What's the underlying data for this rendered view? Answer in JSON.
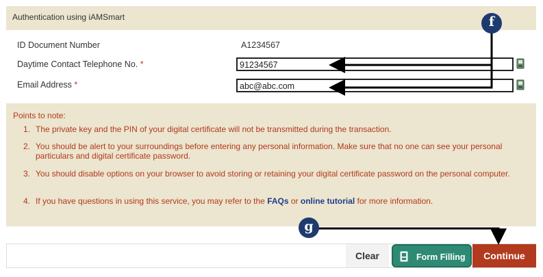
{
  "section": {
    "title": "Authentication using iAMSmart"
  },
  "fields": {
    "id_label": "ID Document Number",
    "id_value": "A1234567",
    "phone_label": "Daytime Contact Telephone No.",
    "phone_value": "91234567",
    "email_label": "Email Address",
    "email_value": "abc@abc.com",
    "required_marker": "*"
  },
  "notes": {
    "heading": "Points to note:",
    "items": [
      {
        "num": "1.",
        "text": "The private key and the PIN of your digital certificate will not be transmitted during the transaction."
      },
      {
        "num": "2.",
        "text": "You should be alert to your surroundings before entering any personal information. Make sure that no one can see your personal particulars and digital certificate password."
      },
      {
        "num": "3.",
        "text": "You should disable options on your browser to avoid storing or retaining your digital certificate password on the personal computer."
      },
      {
        "num": "4.",
        "pre": "If you have questions in using this service, you may refer to the ",
        "link1": "FAQs",
        "mid": " or ",
        "link2": "online tutorial",
        "post": " for more information."
      }
    ]
  },
  "buttons": {
    "clear": "Clear",
    "form_filling": "Form Filling",
    "continue": "Continue"
  },
  "annotations": {
    "badge_f": "f",
    "badge_g": "g"
  },
  "colors": {
    "panel": "#ece5cf",
    "note_text": "#b03a1a",
    "link": "#1d3e8a",
    "form_button": "#2e8a73",
    "continue_button": "#b23a1e",
    "badge": "#1e3a6e"
  }
}
